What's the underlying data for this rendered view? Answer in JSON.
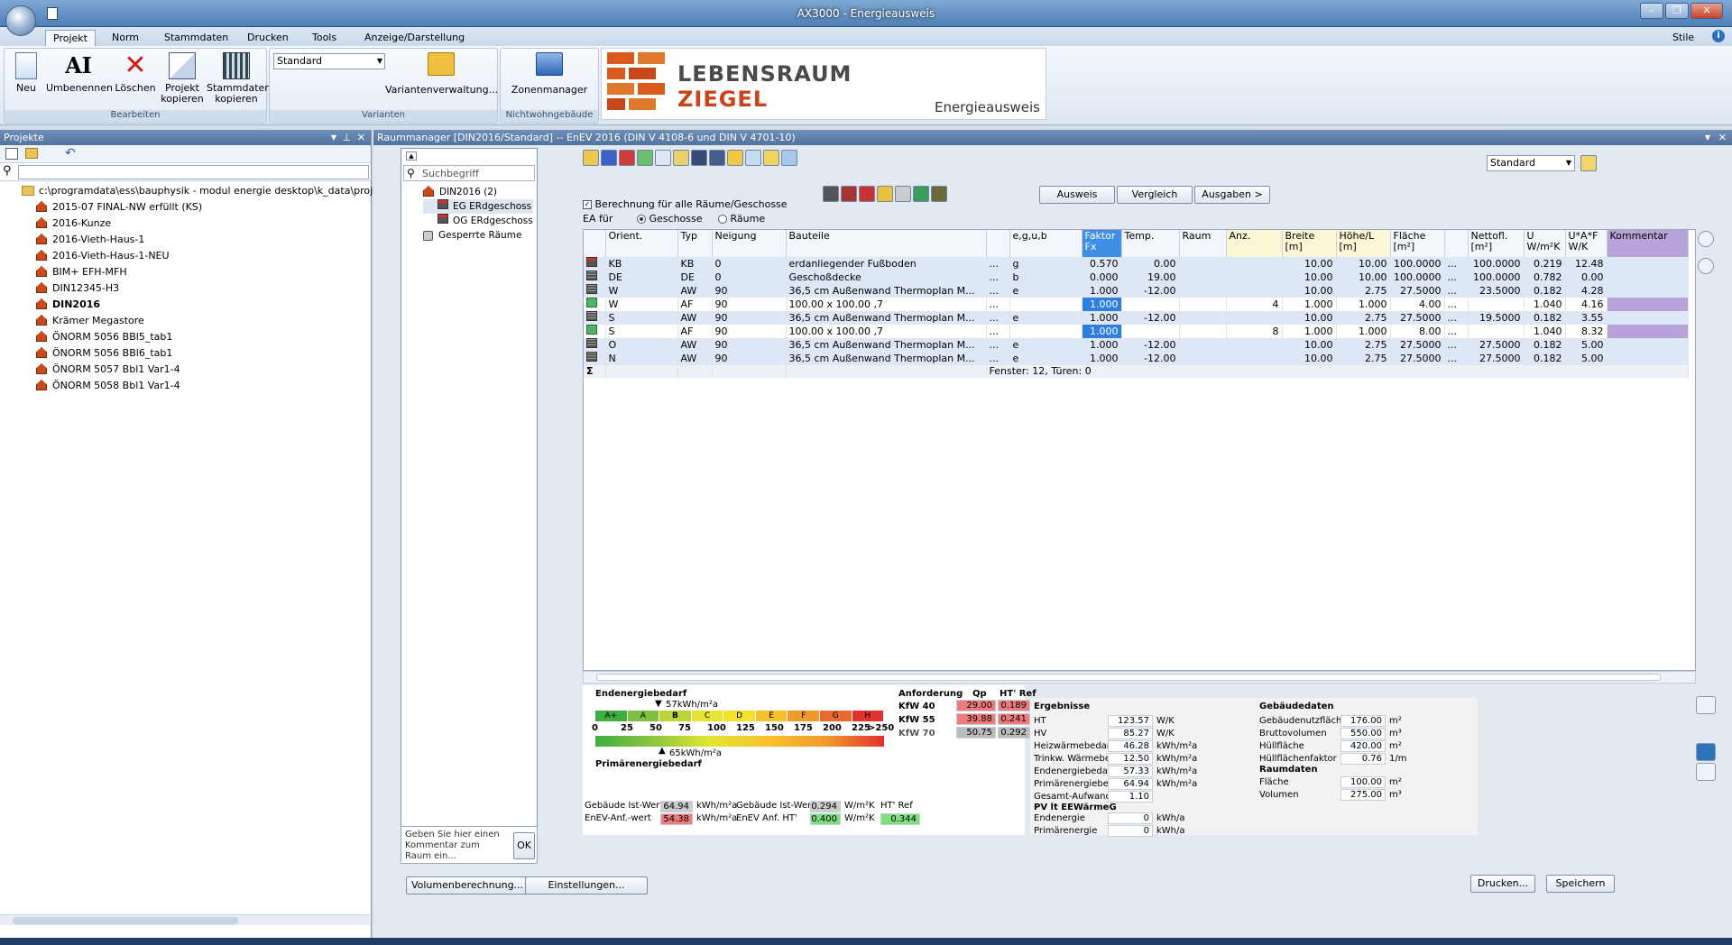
{
  "window": {
    "title": "AX3000 - Energieausweis",
    "style_label": "Stile"
  },
  "tabs": [
    "Projekt",
    "Norm",
    "Stammdaten",
    "Drucken",
    "Tools",
    "Anzeige/Darstellung"
  ],
  "ribbon": {
    "bearbeiten": {
      "label": "Bearbeiten",
      "buttons": [
        "Neu",
        "Umbenennen",
        "Löschen",
        "Projekt kopieren",
        "Stammdaten kopieren"
      ]
    },
    "varianten": {
      "label": "Varianten",
      "combo_value": "Standard",
      "button": "Variantenverwaltung..."
    },
    "nichtwohn": {
      "label": "Nichtwohngebäude",
      "button": "Zonenmanager"
    },
    "logo": {
      "line1": "LEBENSRAUM",
      "line2": "ZIEGEL",
      "caption": "Energieausweis"
    }
  },
  "projects": {
    "title": "Projekte",
    "root": "c:\\programdata\\ess\\bauphysik - modul energie desktop\\k_data\\proje",
    "items": [
      "2015-07 FINAL-NW erfüllt (KS)",
      "2016-Kunze",
      "2016-Vieth-Haus-1",
      "2016-Vieth-Haus-1-NEU",
      "BIM+ EFH-MFH",
      "DIN12345-H3",
      "DIN2016",
      "Krämer Megastore",
      "ÖNORM 5056 BBl5_tab1",
      "ÖNORM 5056 BBl6_tab1",
      "ÖNORM 5057 Bbl1 Var1-4",
      "ÖNORM 5058 Bbl1 Var1-4"
    ]
  },
  "raum": {
    "title": "Raummanager [DIN2016/Standard] -- EnEV 2016 (DIN V 4108-6 und DIN V 4701-10)",
    "search_placeholder": "Suchbegriff",
    "tree": [
      "DIN2016 (2)",
      "EG ERdgeschoss",
      "OG ERdgeschoss",
      "Gesperrte Räume"
    ],
    "comment_placeholder": "Geben Sie hier einen Kommentar zum Raum ein...",
    "ok": "OK",
    "btn_volume": "Volumenberechnung...",
    "btn_settings": "Einstellungen...",
    "variant_combo": "Standard",
    "btn_ausweis": "Ausweis",
    "btn_vergleich": "Vergleich",
    "btn_ausgaben": "Ausgaben >",
    "check_all": "Berechnung für alle Räume/Geschosse",
    "ea_fuer": "EA für",
    "opt_geschosse": "Geschosse",
    "opt_raeume": "Räume"
  },
  "table": {
    "headers": [
      "Orient.",
      "Typ",
      "Neigung",
      "Bauteile",
      "",
      "e,g,u,b",
      "Faktor Fx",
      "Temp.",
      "Raum",
      "Anz.",
      "Breite [m]",
      "Höhe/L [m]",
      "Fläche [m²]",
      "",
      "Nettofl. [m²]",
      "U W/m²K",
      "U*A*F W/K",
      "Kommentar"
    ],
    "rows": [
      [
        "KB",
        "KB",
        "0",
        "erdanliegender Fußboden",
        "...",
        "g",
        "0.570",
        "0.00",
        "",
        "",
        "10.00",
        "10.00",
        "100.0000",
        "...",
        "100.0000",
        "0.219",
        "12.48",
        ""
      ],
      [
        "DE",
        "DE",
        "0",
        "Geschoßdecke",
        "...",
        "b",
        "0.000",
        "19.00",
        "",
        "",
        "10.00",
        "10.00",
        "100.0000",
        "...",
        "100.0000",
        "0.782",
        "0.00",
        ""
      ],
      [
        "W",
        "AW",
        "90",
        "36,5 cm Außenwand Thermoplan M...",
        "...",
        "e",
        "1.000",
        "-12.00",
        "",
        "",
        "10.00",
        "2.75",
        "27.5000",
        "...",
        "23.5000",
        "0.182",
        "4.28",
        ""
      ],
      [
        "W",
        "AF",
        "90",
        "100.00 x 100.00     ,7",
        "...",
        "",
        "1.000",
        "",
        "",
        "4",
        "1.000",
        "1.000",
        "4.00",
        "...",
        "",
        "1.040",
        "4.16",
        ""
      ],
      [
        "S",
        "AW",
        "90",
        "36,5 cm Außenwand Thermoplan M...",
        "...",
        "e",
        "1.000",
        "-12.00",
        "",
        "",
        "10.00",
        "2.75",
        "27.5000",
        "...",
        "19.5000",
        "0.182",
        "3.55",
        ""
      ],
      [
        "S",
        "AF",
        "90",
        "100.00 x 100.00     ,7",
        "...",
        "",
        "1.000",
        "",
        "",
        "8",
        "1.000",
        "1.000",
        "8.00",
        "...",
        "",
        "1.040",
        "8.32",
        ""
      ],
      [
        "O",
        "AW",
        "90",
        "36,5 cm Außenwand Thermoplan M...",
        "...",
        "e",
        "1.000",
        "-12.00",
        "",
        "",
        "10.00",
        "2.75",
        "27.5000",
        "...",
        "27.5000",
        "0.182",
        "5.00",
        ""
      ],
      [
        "N",
        "AW",
        "90",
        "36,5 cm Außenwand Thermoplan M...",
        "...",
        "e",
        "1.000",
        "-12.00",
        "",
        "",
        "10.00",
        "2.75",
        "27.5000",
        "...",
        "27.5000",
        "0.182",
        "5.00",
        ""
      ]
    ],
    "summary": "Fenster: 12, Türen: 0"
  },
  "energy": {
    "end_label": "Endenergiebedarf",
    "end_value": "57kWh/m²a",
    "prim_label": "Primärenergiebedarf",
    "prim_value": "65kWh/m²a",
    "classes": [
      "A+",
      "A",
      "B",
      "C",
      "D",
      "E",
      "F",
      "G",
      "H"
    ],
    "class_colors": [
      "#3fae3f",
      "#7ec142",
      "#bcd43a",
      "#e3e531",
      "#f5e02e",
      "#f7c12d",
      "#f19a2c",
      "#e8692f",
      "#e0322f"
    ],
    "scale": [
      "0",
      "25",
      "50",
      "75",
      "100",
      "125",
      "150",
      "175",
      "200",
      "225",
      ">250"
    ],
    "anforderung": {
      "title": "Anforderung",
      "qp": "Qp",
      "ht": "HT' Ref",
      "rows": [
        [
          "KfW 40",
          "29.00",
          "0.189"
        ],
        [
          "KfW 55",
          "39.88",
          "0.241"
        ],
        [
          "KfW 70",
          "50.75",
          "0.292"
        ]
      ]
    },
    "ist": {
      "l1": "Gebäude Ist-Wert",
      "v1": "64.94",
      "u1": "kWh/m²a",
      "l2": "EnEV-Anf.-wert",
      "v2": "54.38",
      "u2": "kWh/m²a",
      "l3": "Gebäude Ist-Wert HT'",
      "v3": "0.294",
      "u3": "W/m²K",
      "l4": "EnEV Anf. HT'",
      "v4": "0.400",
      "u4": "W/m²K",
      "l5": "HT' Ref",
      "v5": "0.344"
    }
  },
  "results": {
    "title": "Ergebnisse",
    "rows": [
      [
        "HT",
        "123.57",
        "W/K"
      ],
      [
        "HV",
        "85.27",
        "W/K"
      ],
      [
        "Heizwärmebedarf",
        "46.28",
        "kWh/m²a"
      ],
      [
        "Trinkw. Wärmebed.",
        "12.50",
        "kWh/m²a"
      ],
      [
        "Endenergiebedarf",
        "57.33",
        "kWh/m²a"
      ],
      [
        "Primärenergiebed. vor",
        "64.94",
        "kWh/m²a"
      ],
      [
        "Gesamt-Aufwandsz.",
        "1.10",
        ""
      ]
    ],
    "pv_title": "PV lt EEWärmeG",
    "pv_rows": [
      [
        "Endenergie",
        "0",
        "kWh/a"
      ],
      [
        "Primärenergie",
        "0",
        "kWh/a"
      ]
    ],
    "building_title": "Gebäudedaten",
    "building": [
      [
        "Gebäudenutzfläche AN",
        "176.00",
        "m²"
      ],
      [
        "Bruttovolumen",
        "550.00",
        "m³"
      ],
      [
        "Hüllfläche",
        "420.00",
        "m²"
      ],
      [
        "Hüllflächenfaktor",
        "0.76",
        "1/m"
      ]
    ],
    "room_title": "Raumdaten",
    "room": [
      [
        "Fläche",
        "100.00",
        "m²"
      ],
      [
        "Volumen",
        "275.00",
        "m³"
      ]
    ],
    "btn_print": "Drucken...",
    "btn_save": "Speichern"
  }
}
